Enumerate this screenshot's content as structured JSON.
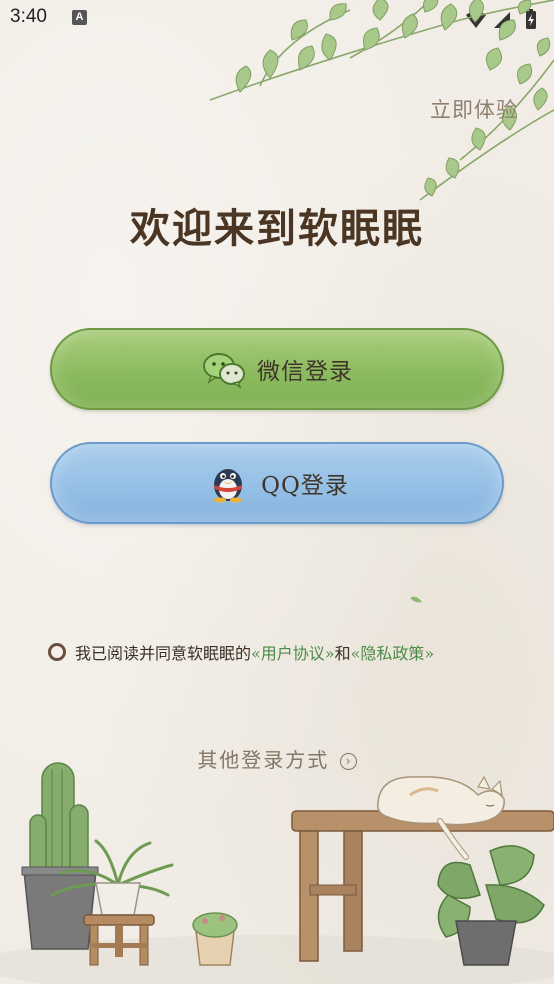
{
  "status_bar": {
    "time": "3:40",
    "notification_icon": "A"
  },
  "header": {
    "skip_label": "立即体验"
  },
  "main": {
    "title": "欢迎来到软眠眠",
    "wechat_login": "微信登录",
    "qq_login": "QQ登录"
  },
  "agreement": {
    "prefix": "我已阅读并同意软眠眠的",
    "user_agreement": "«用户协议»",
    "conjunction": "和",
    "privacy_policy": "«隐私政策»"
  },
  "footer": {
    "other_login": "其他登录方式",
    "other_login_icon": "chevron-right-circle-icon"
  },
  "colors": {
    "wechat_button": "#8cbb5f",
    "qq_button": "#95c0e6",
    "title_text": "#4b3523",
    "link": "#4d8a45"
  }
}
